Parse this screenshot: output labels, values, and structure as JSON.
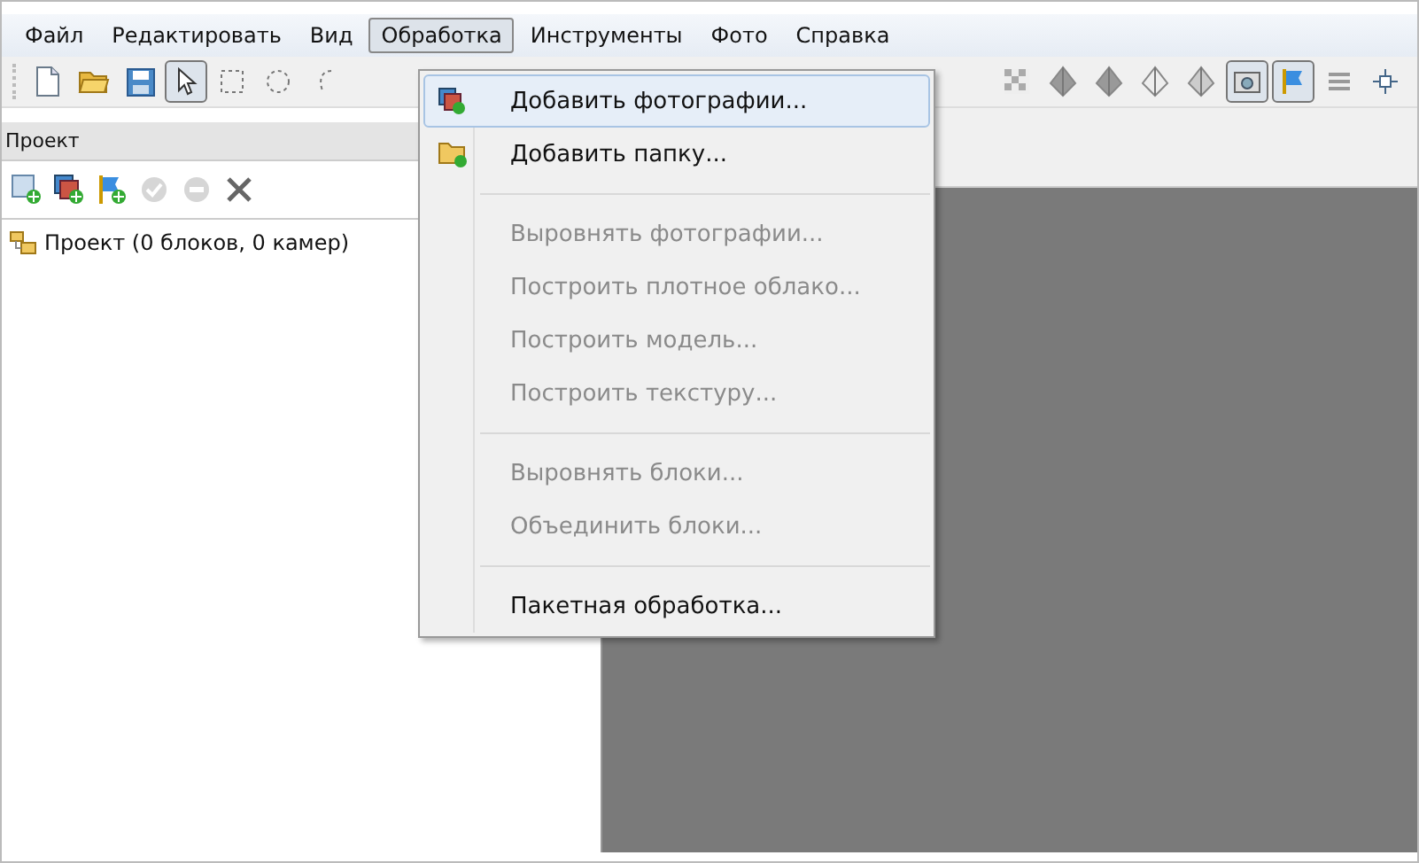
{
  "menubar": [
    {
      "label": "Файл",
      "selected": false
    },
    {
      "label": "Редактировать",
      "selected": false
    },
    {
      "label": "Вид",
      "selected": false
    },
    {
      "label": "Обработка",
      "selected": true
    },
    {
      "label": "Инструменты",
      "selected": false
    },
    {
      "label": "Фото",
      "selected": false
    },
    {
      "label": "Справка",
      "selected": false
    }
  ],
  "toolbar_left": [
    {
      "kind": "new",
      "on": false
    },
    {
      "kind": "open",
      "on": false
    },
    {
      "kind": "save",
      "on": false
    },
    {
      "kind": "pointer",
      "on": true
    },
    {
      "kind": "rect",
      "on": false
    },
    {
      "kind": "ellipse",
      "on": false
    },
    {
      "kind": "lasso",
      "on": false
    }
  ],
  "toolbar_right": [
    {
      "kind": "checker",
      "on": false
    },
    {
      "kind": "pyramid",
      "on": false
    },
    {
      "kind": "pyramid",
      "on": false
    },
    {
      "kind": "pyramid-outline",
      "on": false
    },
    {
      "kind": "pyramid-light",
      "on": false
    },
    {
      "kind": "camera",
      "on": true
    },
    {
      "kind": "flag",
      "on": true
    },
    {
      "kind": "layers",
      "on": false
    },
    {
      "kind": "move",
      "on": false
    }
  ],
  "project_panel": {
    "title": "Проект",
    "tools": [
      {
        "kind": "add-chunk",
        "disabled": false
      },
      {
        "kind": "add-photos",
        "disabled": false
      },
      {
        "kind": "add-markers",
        "disabled": false
      },
      {
        "kind": "check",
        "disabled": true
      },
      {
        "kind": "minus",
        "disabled": true
      },
      {
        "kind": "remove",
        "disabled": false
      }
    ],
    "tree": [
      {
        "label": "Проект (0 блоков, 0 камер)"
      }
    ]
  },
  "menu": [
    {
      "kind": "item",
      "label": "Добавить фотографии...",
      "disabled": false,
      "selected": true
    },
    {
      "kind": "item",
      "label": "Добавить папку...",
      "disabled": false,
      "selected": false
    },
    {
      "kind": "separator"
    },
    {
      "kind": "item",
      "label": "Выровнять фотографии...",
      "disabled": true,
      "selected": false
    },
    {
      "kind": "item",
      "label": "Построить плотное облако...",
      "disabled": true,
      "selected": false
    },
    {
      "kind": "item",
      "label": "Построить модель...",
      "disabled": true,
      "selected": false
    },
    {
      "kind": "item",
      "label": "Построить текстуру...",
      "disabled": true,
      "selected": false
    },
    {
      "kind": "separator"
    },
    {
      "kind": "item",
      "label": "Выровнять блоки...",
      "disabled": true,
      "selected": false
    },
    {
      "kind": "item",
      "label": "Объединить блоки...",
      "disabled": true,
      "selected": false
    },
    {
      "kind": "separator"
    },
    {
      "kind": "item",
      "label": "Пакетная обработка...",
      "disabled": false,
      "selected": false
    }
  ]
}
